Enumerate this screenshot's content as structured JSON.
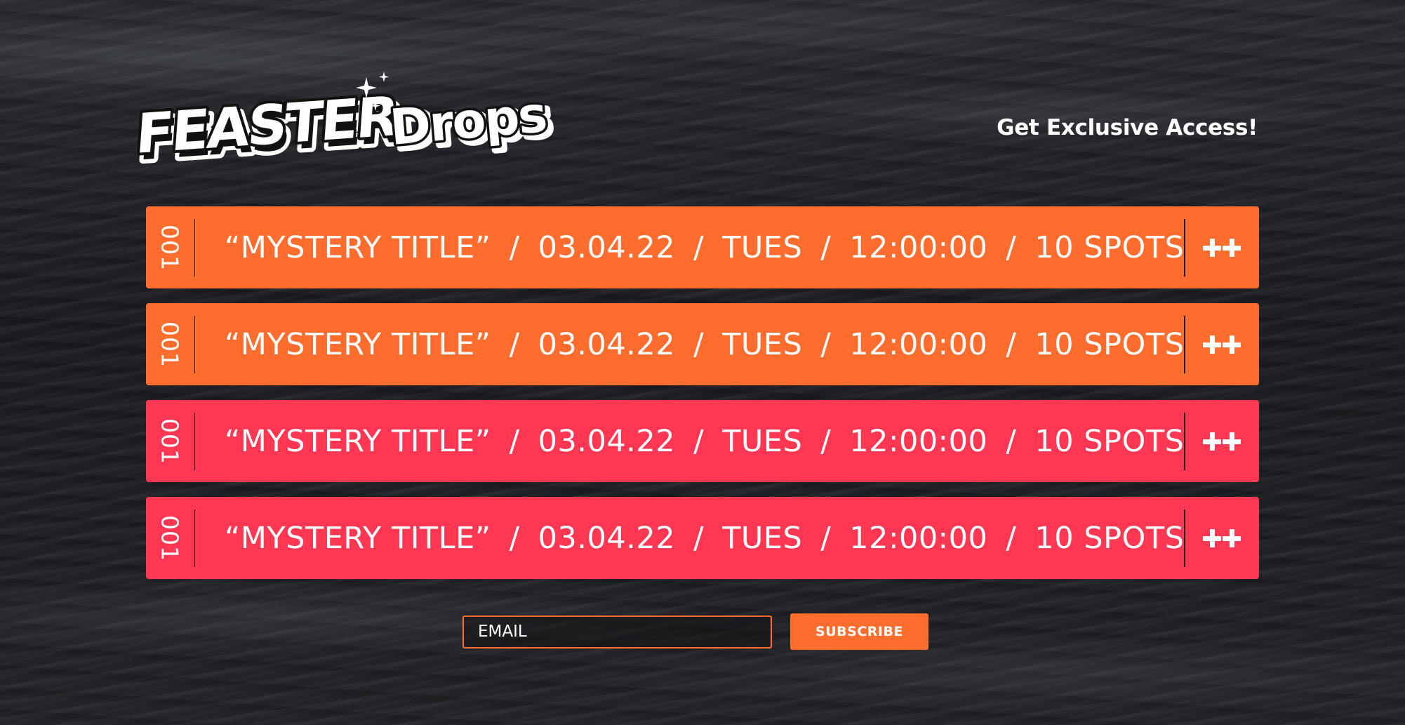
{
  "logo": {
    "brand": "FEASTER",
    "product": "Drops"
  },
  "header": {
    "cta": "Get Exclusive Access!"
  },
  "drops": [
    {
      "number": "001",
      "title": "“MYSTERY TITLE”",
      "date": "03.04.22",
      "day": "TUES",
      "time": "12:00:00",
      "spots": "10 SPOTS",
      "action": "++",
      "color": "#ff6d2e"
    },
    {
      "number": "001",
      "title": "“MYSTERY TITLE”",
      "date": "03.04.22",
      "day": "TUES",
      "time": "12:00:00",
      "spots": "10 SPOTS",
      "action": "++",
      "color": "#ff6d2e"
    },
    {
      "number": "001",
      "title": "“MYSTERY TITLE”",
      "date": "03.04.22",
      "day": "TUES",
      "time": "12:00:00",
      "spots": "10 SPOTS",
      "action": "++",
      "color": "#ff3752"
    },
    {
      "number": "001",
      "title": "“MYSTERY TITLE”",
      "date": "03.04.22",
      "day": "TUES",
      "time": "12:00:00",
      "spots": "10 SPOTS",
      "action": "++",
      "color": "#ff3752"
    }
  ],
  "separator": "/",
  "subscribe": {
    "placeholder": "EMAIL",
    "value": "",
    "button_label": "SUBSCRIBE"
  },
  "colors": {
    "orange": "#ff6d2e",
    "red": "#ff3752",
    "background": "#1f2024"
  }
}
